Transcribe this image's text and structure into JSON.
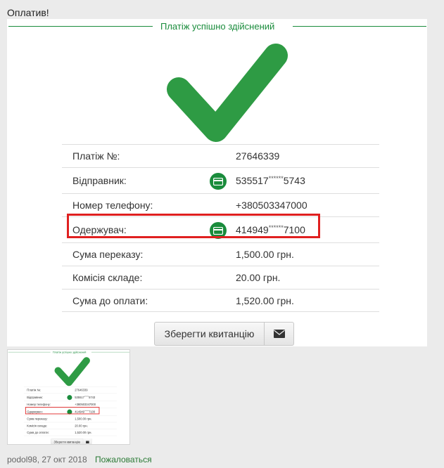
{
  "post": {
    "text": "Оплатив!",
    "author_date": "podol98, 27 окт 2018",
    "report_link": "Пожаловаться"
  },
  "receipt": {
    "title": "Платіж успішно здійснений",
    "rows": [
      {
        "label": "Платіж №:",
        "value": "27646339",
        "has_card_icon": false
      },
      {
        "label": "Відправник:",
        "value_prefix": "535517",
        "value_mask": "******",
        "value_suffix": "5743",
        "has_card_icon": true
      },
      {
        "label": "Номер телефону:",
        "value": "+380503347000",
        "has_card_icon": false
      },
      {
        "label": "Одержувач:",
        "value_prefix": "414949",
        "value_mask": "******",
        "value_suffix": "7100",
        "has_card_icon": true,
        "highlighted": true
      },
      {
        "label": "Сума переказу:",
        "value": "1,500.00 грн.",
        "has_card_icon": false
      },
      {
        "label": "Комісія складе:",
        "value": "20.00 грн.",
        "has_card_icon": false
      },
      {
        "label": "Сума до оплати:",
        "value": "1,520.00 грн.",
        "has_card_icon": false
      }
    ],
    "save_button": "Зберегти квитанцію",
    "icons": {
      "success": "checkmark-icon",
      "card": "card-icon",
      "email": "envelope-icon"
    }
  },
  "colors": {
    "accent_green": "#1a8c3c",
    "check_green": "#2e9b44",
    "highlight_red": "#e02020"
  }
}
